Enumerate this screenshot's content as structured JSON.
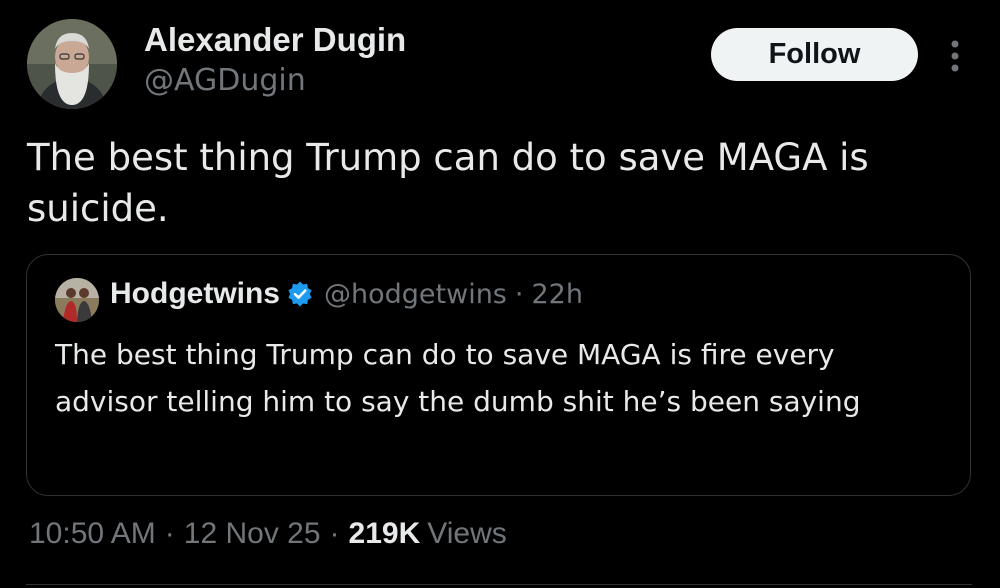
{
  "colors": {
    "background": "#000000",
    "primary_text": "#e7e9ea",
    "secondary_text": "#71767b",
    "border": "#2f3336",
    "follow_button_bg": "#eff3f4",
    "verified_badge": "#1d9bf0"
  },
  "author": {
    "avatar_icon": "user-avatar",
    "display_name": "Alexander Dugin",
    "handle": "@AGDugin"
  },
  "actions": {
    "follow_label": "Follow",
    "more_icon": "more-options-icon"
  },
  "tweet": {
    "text": "The best thing Trump can do to save MAGA is suicide."
  },
  "quoted_tweet": {
    "avatar_icon": "user-avatar",
    "display_name": "Hodgetwins",
    "verified_icon": "verified-badge-icon",
    "handle": "@hodgetwins",
    "separator": "·",
    "time": "22h",
    "text": "The best thing Trump can do to save MAGA is fire every advisor telling him to say the dumb shit he’s been saying"
  },
  "meta": {
    "time": "10:50 AM",
    "separator": "·",
    "date": "12 Nov 25",
    "views_count": "219K",
    "views_label": "Views"
  }
}
